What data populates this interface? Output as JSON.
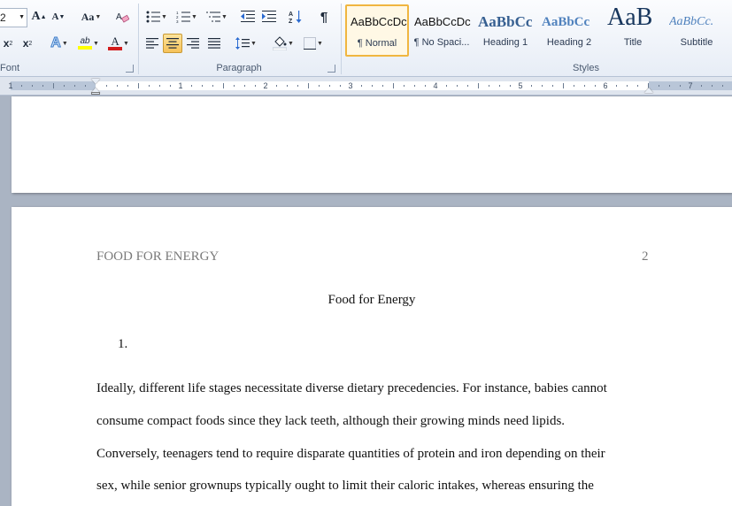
{
  "ribbon": {
    "font": {
      "size_value": "2",
      "grow_font_label": "A",
      "shrink_font_label": "A",
      "change_case_label": "Aa",
      "subscript_label": "x",
      "superscript_label": "x",
      "highlight_label": "ab",
      "font_color_label": "A",
      "group_label": "Font"
    },
    "paragraph": {
      "group_label": "Paragraph",
      "pilcrow": "¶"
    },
    "styles": {
      "group_label": "Styles",
      "items": [
        {
          "sample": "AaBbCcDc",
          "name": "¶ Normal"
        },
        {
          "sample": "AaBbCcDc",
          "name": "¶ No Spaci..."
        },
        {
          "sample": "AaBbCc",
          "name": "Heading 1"
        },
        {
          "sample": "AaBbCc",
          "name": "Heading 2"
        },
        {
          "sample": "AaB",
          "name": "Title"
        },
        {
          "sample": "AaBbCc.",
          "name": "Subtitle"
        }
      ]
    },
    "colors": {
      "accent": "#f6c25a",
      "highlight": "#ffff00",
      "font_color": "#d21c1c"
    }
  },
  "ruler": {
    "numbers": [
      "1",
      "1",
      "2",
      "3",
      "4",
      "5",
      "6",
      "7"
    ]
  },
  "document": {
    "running_head": "FOOD FOR ENERGY",
    "page_number": "2",
    "title": "Food for Energy",
    "list_marker": "1.",
    "paragraph_lines": [
      "Ideally, different life stages necessitate diverse dietary precedencies. For instance, babies cannot",
      "consume compact foods since they lack teeth, although their growing minds need lipids.",
      "Conversely, teenagers tend to require disparate quantities of protein and iron depending on their",
      "sex, while senior grownups typically ought to limit their caloric intakes, whereas ensuring the"
    ]
  }
}
